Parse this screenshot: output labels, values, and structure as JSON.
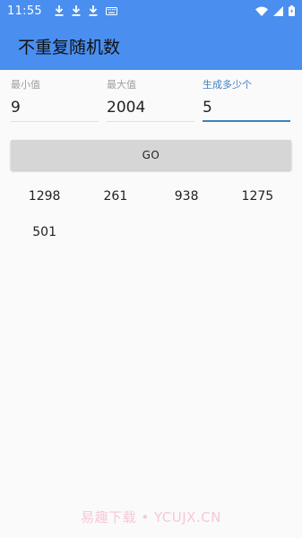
{
  "status_bar": {
    "time": "11:55",
    "left_icons": [
      "download-icon",
      "download-icon",
      "download-icon",
      "keyboard-icon"
    ],
    "right_icons": [
      "wifi-icon",
      "signal-icon",
      "battery-icon"
    ]
  },
  "app_bar": {
    "title": "不重复随机数"
  },
  "fields": {
    "min": {
      "label": "最小值",
      "value": "9"
    },
    "max": {
      "label": "最大值",
      "value": "2004"
    },
    "count": {
      "label": "生成多少个",
      "value": "5"
    }
  },
  "go_button": {
    "label": "GO"
  },
  "results": [
    "1298",
    "261",
    "938",
    "1275",
    "501"
  ],
  "watermark": "易趣下载 • YCUJX.CN",
  "colors": {
    "primary": "#4a8ef0",
    "accent": "#3f7fc1",
    "button": "#d6d6d6"
  }
}
